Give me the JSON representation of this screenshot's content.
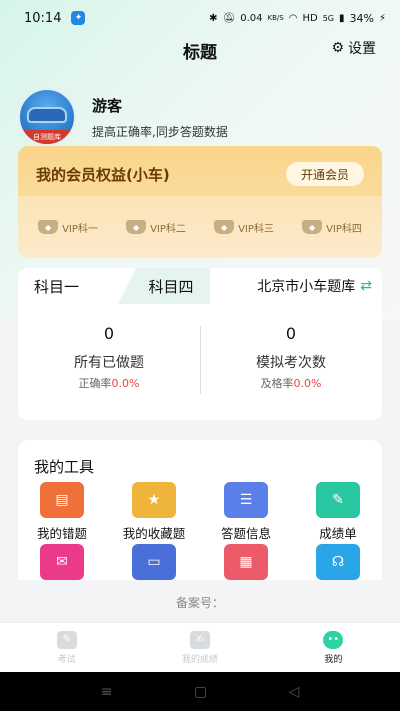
{
  "status_bar": {
    "time": "10:14",
    "network_speed": "0.04",
    "network_speed_unit": "KB/S",
    "network_type": "HD",
    "signal": "5G",
    "battery": "34%"
  },
  "header": {
    "title": "标题",
    "settings_label": "设置"
  },
  "profile": {
    "name": "游客",
    "subtitle": "提高正确率,同步答题数据",
    "avatar_band_text": "自测题库"
  },
  "vip": {
    "title": "我的会员权益(小车)",
    "open_button": "开通会员",
    "items": [
      "VIP科一",
      "VIP科二",
      "VIP科三",
      "VIP科四"
    ]
  },
  "subjects": {
    "tab1": "科目一",
    "tab2": "科目四",
    "bank": "北京市小车题库",
    "done_count": "0",
    "done_label": "所有已做题",
    "accuracy_label": "正确率",
    "accuracy_value": "0.0%",
    "exam_count": "0",
    "exam_label": "模拟考次数",
    "pass_label": "及格率",
    "pass_value": "0.0%"
  },
  "tools": {
    "title": "我的工具",
    "items": [
      {
        "label": "我的错题",
        "color": "#f0703a"
      },
      {
        "label": "我的收藏题",
        "color": "#efb53a"
      },
      {
        "label": "答题信息",
        "color": "#5a7fe8"
      },
      {
        "label": "成绩单",
        "color": "#29c7a1"
      },
      {
        "label": "",
        "color": "#ec3a8a"
      },
      {
        "label": "",
        "color": "#4a6fd8"
      },
      {
        "label": "",
        "color": "#ec5a6a"
      },
      {
        "label": "",
        "color": "#2aa6e8"
      }
    ]
  },
  "record": "备案号：",
  "tabbar": [
    "考试",
    "我的成绩",
    "我的"
  ],
  "colors": {
    "accent": "#2ed3a4",
    "vip_text": "#6a3a06",
    "rate_red": "#e44"
  }
}
